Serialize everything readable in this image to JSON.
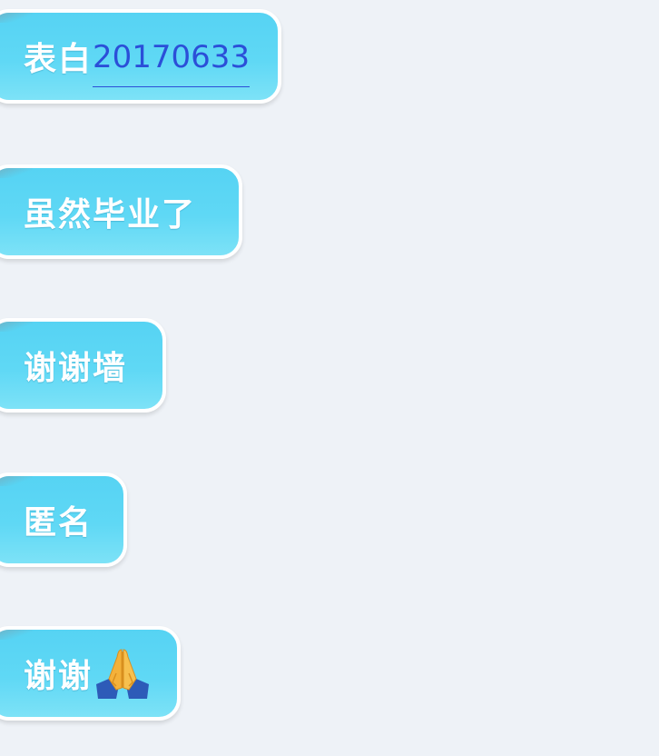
{
  "messages": [
    {
      "text": "表白",
      "link": "20170633"
    },
    {
      "text": "虽然毕业了"
    },
    {
      "text": "谢谢墙"
    },
    {
      "text": "匿名"
    },
    {
      "text": "谢谢",
      "emoji": "folded-hands-icon"
    }
  ],
  "colors": {
    "background": "#eef2f7",
    "bubble": "#5fd8f5",
    "bubble_border": "#ffffff",
    "text": "#ffffff",
    "link": "#2b4fd8"
  }
}
